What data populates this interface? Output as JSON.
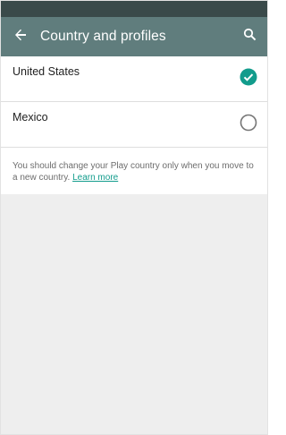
{
  "header": {
    "title": "Country and profiles",
    "back_icon": "arrow-back-icon",
    "search_icon": "search-icon",
    "color": "#607d7d"
  },
  "countries": [
    {
      "name": "United States",
      "selected": true
    },
    {
      "name": "Mexico",
      "selected": false
    }
  ],
  "note": {
    "text": "You should change your Play country only when you move to a new country.",
    "link": "Learn more"
  },
  "accent": "#129c8c"
}
